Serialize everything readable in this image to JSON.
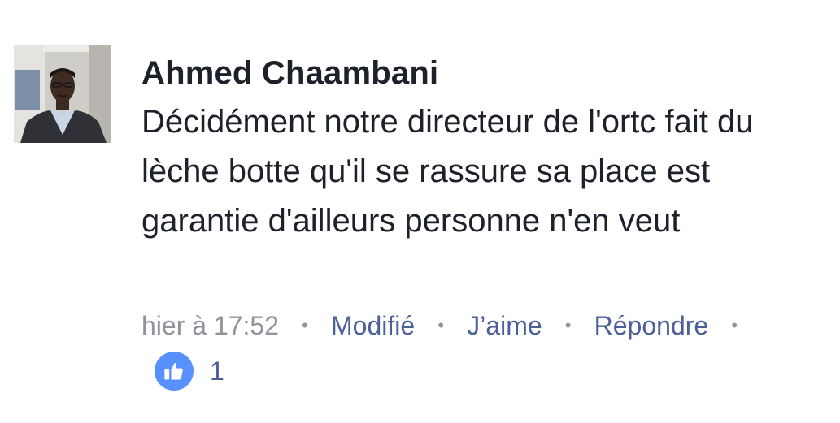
{
  "comment": {
    "author": "Ahmed Chaambani",
    "text": "Décidément notre directeur de l'ortc fait du lèche botte qu'il se rassure sa place est garantie d'ailleurs personne n'en veut",
    "timestamp": "hier à 17:52",
    "separator": "•",
    "edited_label": "Modifié",
    "like_label": "J’aime",
    "reply_label": "Répondre",
    "reaction_icon": "thumbs-up-icon",
    "reaction_count": "1"
  },
  "colors": {
    "text": "#1d2129",
    "meta_gray": "#90949c",
    "link_blue": "#4b6099",
    "like_bubble": "#5890ff"
  }
}
